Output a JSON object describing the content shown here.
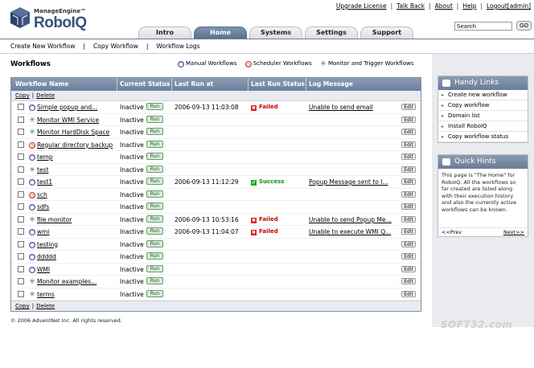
{
  "brand": {
    "top": "ManageEngine™",
    "main": "RoboIQ"
  },
  "toplinks": [
    "Upgrade License",
    "Talk Back",
    "About",
    "Help",
    "Logout[admin]"
  ],
  "search": {
    "value": "Search",
    "go": "GO"
  },
  "tabs": [
    {
      "label": "Intro",
      "active": false
    },
    {
      "label": "Home",
      "active": true
    },
    {
      "label": "Systems",
      "active": false
    },
    {
      "label": "Settings",
      "active": false
    },
    {
      "label": "Support",
      "active": false
    }
  ],
  "subnav": [
    "Create New Workflow",
    "Copy Workflow",
    "Workflow Logs"
  ],
  "main": {
    "title": "Workflows",
    "legend": [
      "Manual Workflows",
      "Scheduler Workflows",
      "Monitor and Trigger Workflows"
    ],
    "columns": [
      "Workflow Name",
      "Current Status",
      "Last Run at",
      "Last Run Status",
      "Log Message"
    ],
    "actions": {
      "copy": "Copy",
      "delete": "Delete"
    },
    "run_label": "Run",
    "edit_label": "Edit",
    "rows": [
      {
        "type": "manual",
        "name": "Simple popup and...",
        "status": "Inactive",
        "last_run": "2006-09-13 11:03:08",
        "run_status": "Failed",
        "log": "Unable to send email"
      },
      {
        "type": "trigger",
        "name": "Monitor WMI Service",
        "status": "Inactive",
        "last_run": "",
        "run_status": "",
        "log": ""
      },
      {
        "type": "trigger",
        "name": "Monitor HardDisk Space",
        "status": "Inactive",
        "last_run": "",
        "run_status": "",
        "log": ""
      },
      {
        "type": "sched",
        "name": "Regular directory backup",
        "status": "Inactive",
        "last_run": "",
        "run_status": "",
        "log": ""
      },
      {
        "type": "manual",
        "name": "temp",
        "status": "Inactive",
        "last_run": "",
        "run_status": "",
        "log": ""
      },
      {
        "type": "trigger",
        "name": "test",
        "status": "Inactive",
        "last_run": "",
        "run_status": "",
        "log": ""
      },
      {
        "type": "manual",
        "name": "test1",
        "status": "Inactive",
        "last_run": "2006-09-13 11:12:29",
        "run_status": "Success",
        "log": "Popup Message sent to l..."
      },
      {
        "type": "sched",
        "name": "sch",
        "status": "Inactive",
        "last_run": "",
        "run_status": "",
        "log": ""
      },
      {
        "type": "manual",
        "name": "sdfs",
        "status": "Inactive",
        "last_run": "",
        "run_status": "",
        "log": ""
      },
      {
        "type": "trigger",
        "name": "file monitor",
        "status": "Inactive",
        "last_run": "2006-09-13 10:53:16",
        "run_status": "Failed",
        "log": "Unable to send Popup Me..."
      },
      {
        "type": "manual",
        "name": "wmi",
        "status": "Inactive",
        "last_run": "2006-09-13 11:04:07",
        "run_status": "Failed",
        "log": "Unable to execute WMI Q..."
      },
      {
        "type": "manual",
        "name": "testing",
        "status": "Inactive",
        "last_run": "",
        "run_status": "",
        "log": ""
      },
      {
        "type": "manual",
        "name": "ddddd",
        "status": "Inactive",
        "last_run": "",
        "run_status": "",
        "log": ""
      },
      {
        "type": "manual",
        "name": "WMI",
        "status": "Inactive",
        "last_run": "",
        "run_status": "",
        "log": ""
      },
      {
        "type": "trigger",
        "name": "Monitor examples...",
        "status": "Inactive",
        "last_run": "",
        "run_status": "",
        "log": ""
      },
      {
        "type": "trigger",
        "name": "terms",
        "status": "Inactive",
        "last_run": "",
        "run_status": "",
        "log": ""
      }
    ],
    "footer": "© 2006 AdventNet Inc. All rights reserved."
  },
  "handy_links": {
    "title": "Handy Links",
    "items": [
      "Create new workflow",
      "Copy workflow",
      "Domain list",
      "Install RoboIQ",
      "Copy workflow status"
    ]
  },
  "quick_hints": {
    "title": "Quick Hints",
    "text": "This page is \"The Home\" for RoboIQ. All the workflows so far created are listed along with their execution history and also the currently active workflows can be known.",
    "prev": "<<Prev",
    "next": "Next>>"
  },
  "watermark": "SOFT32.com"
}
